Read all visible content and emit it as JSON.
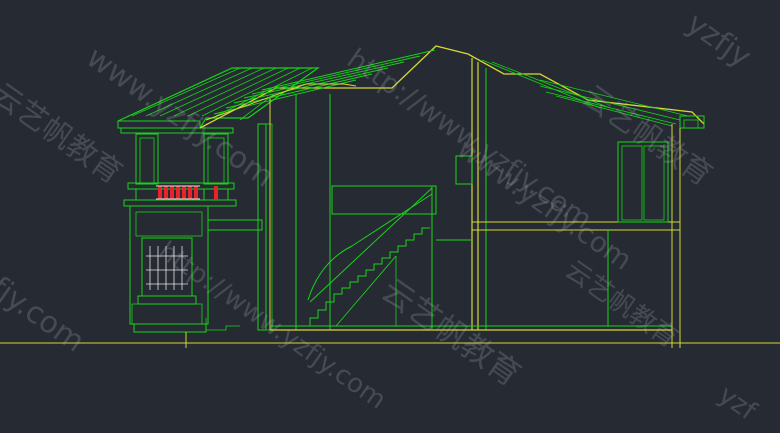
{
  "viewport": {
    "background": "#252a33"
  },
  "palette": {
    "green": "#19d219",
    "yellow": "#d8d832",
    "red": "#e8232a",
    "white": "#e6e6e6"
  },
  "watermarks": [
    {
      "id": "wm-1",
      "text": "www.yzfjy.com"
    },
    {
      "id": "wm-2",
      "text": "云艺帆教育"
    },
    {
      "id": "wm-3",
      "text": "http://www.yzfjy.com"
    },
    {
      "id": "wm-4",
      "text": "云艺帆教育"
    },
    {
      "id": "wm-5",
      "text": "http://www.yzfjy.com"
    },
    {
      "id": "wm-6",
      "text": "yzfjy"
    },
    {
      "id": "wm-7",
      "text": "fjy.com"
    },
    {
      "id": "wm-8",
      "text": "云艺帆教育"
    },
    {
      "id": "wm-9",
      "text": "www.yzfjy.com"
    },
    {
      "id": "wm-10",
      "text": "云艺帆教育"
    },
    {
      "id": "wm-11",
      "text": "yzf"
    }
  ]
}
